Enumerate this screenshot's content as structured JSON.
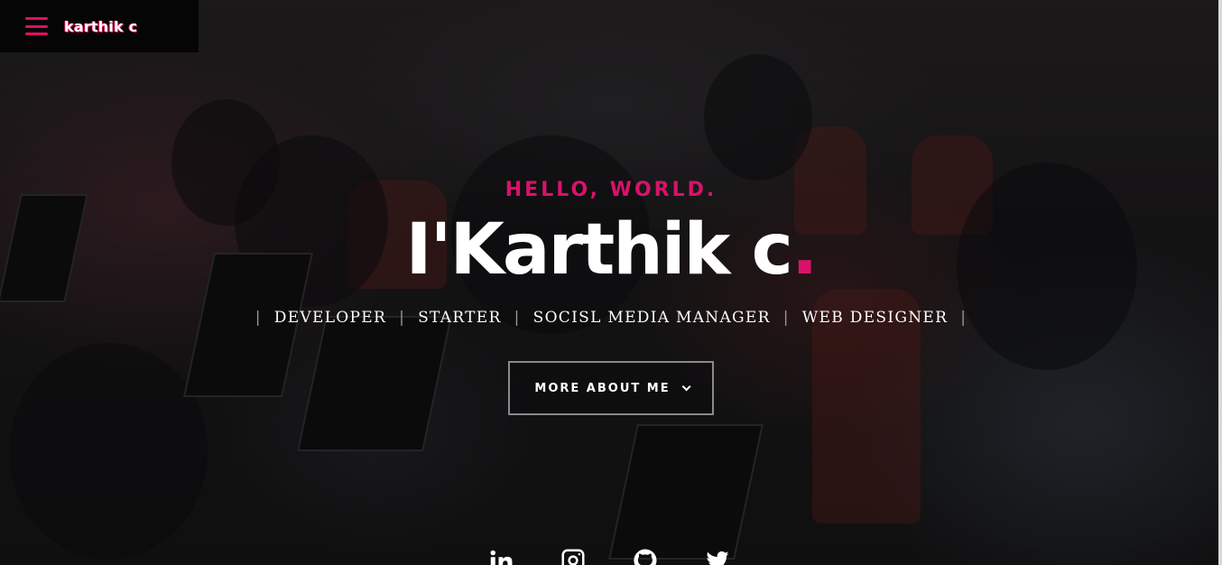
{
  "header": {
    "brand": "karthik c",
    "menu_icon": "hamburger-menu-icon"
  },
  "hero": {
    "greeting": "HELLO, WORLD.",
    "headline": "I'Karthik c",
    "headline_dot": ".",
    "roles": [
      "DEVELOPER",
      "STARTER",
      "SOCISL MEDIA MANAGER",
      "WEB DESIGNER"
    ],
    "separator": "|",
    "cta_label": "MORE ABOUT ME",
    "cta_icon": "chevron-down-icon"
  },
  "socials": [
    {
      "icon": "linkedin-icon"
    },
    {
      "icon": "instagram-icon"
    },
    {
      "icon": "github-icon"
    },
    {
      "icon": "twitter-icon"
    }
  ],
  "colors": {
    "accent": "#d8126a",
    "text": "#ffffff",
    "bar": "#050505"
  }
}
